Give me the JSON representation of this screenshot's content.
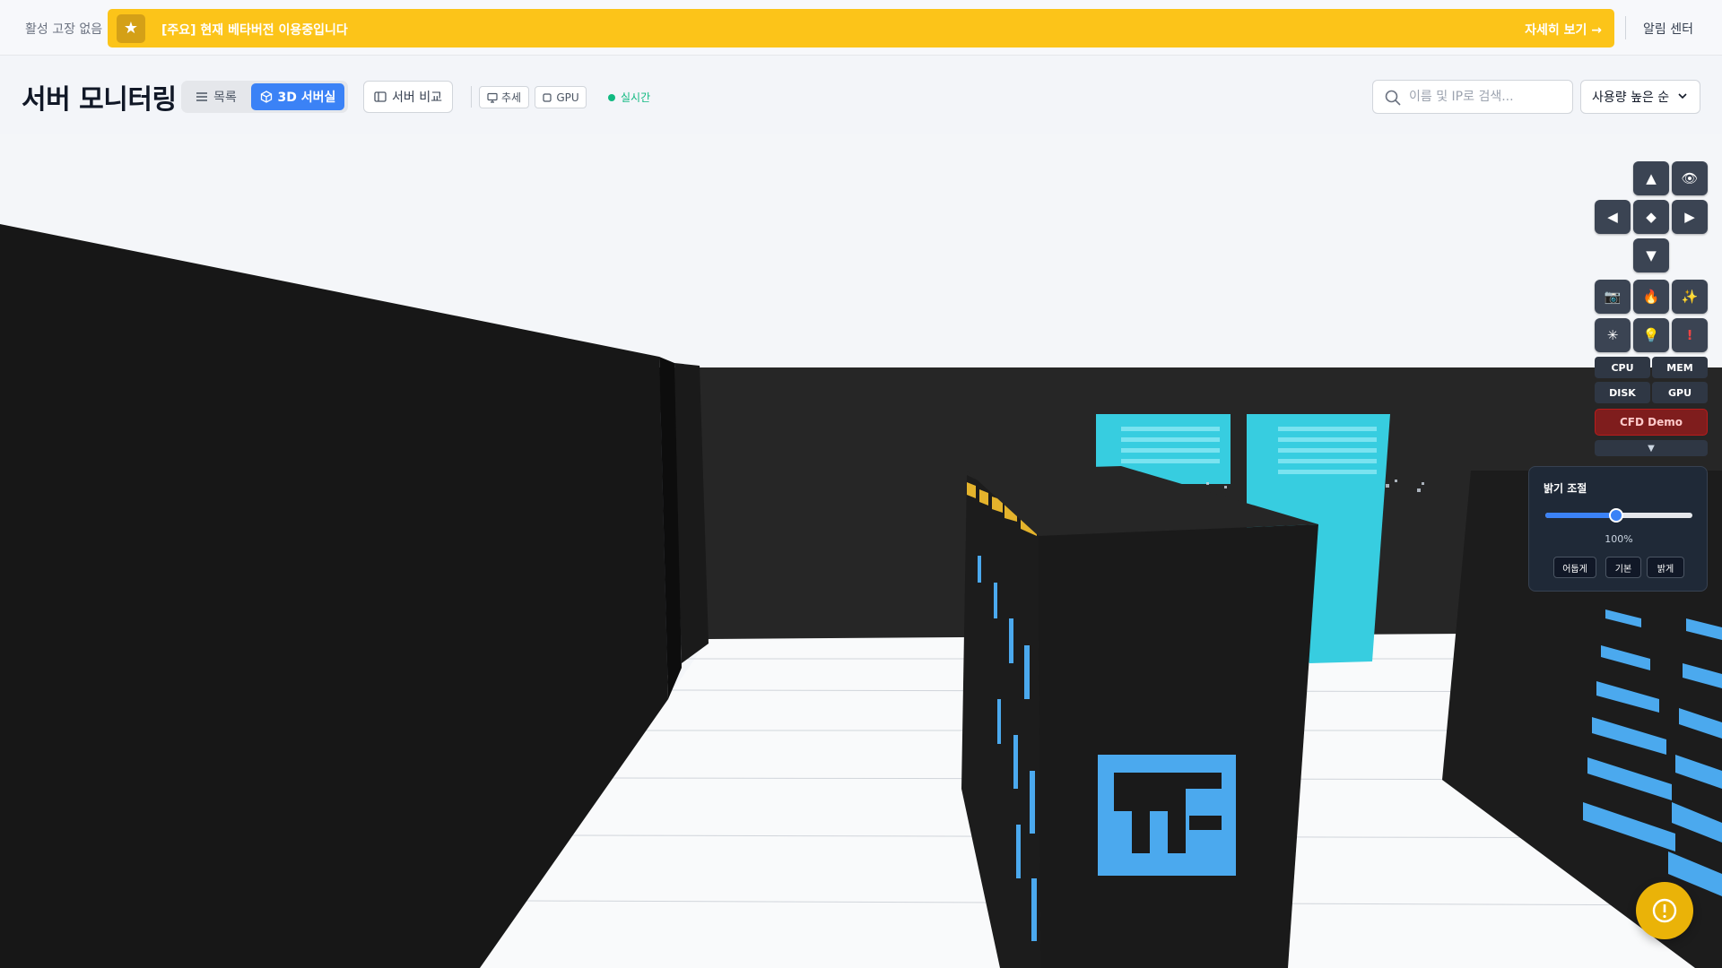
{
  "topbar": {
    "fault_status": "활성 고장 없음",
    "banner_text": "[주요] 현재 베타버전 이용중입니다",
    "banner_link": "자세히 보기 →",
    "alert_center": "알림 센터"
  },
  "header": {
    "title": "서버 모니터링",
    "view_list": "목록",
    "view_3d": "3D 서버실",
    "compare": "서버 비교",
    "chip_trend": "추세",
    "chip_gpu": "GPU",
    "live": "실시간",
    "search_placeholder": "이름 및 IP로 검색...",
    "sort_value": "사용량 높은 순"
  },
  "controls": {
    "metrics": [
      "CPU",
      "MEM",
      "DISK",
      "GPU"
    ],
    "cfd_demo": "CFD Demo"
  },
  "brightness": {
    "title": "밝기 조절",
    "value_label": "100%",
    "slider_fraction": 0.48,
    "buttons": [
      "어둡게",
      "기본",
      "밝게"
    ]
  },
  "colors": {
    "banner": "#fcc419",
    "accent": "#3b82f6",
    "live": "#10b981",
    "rack_dark": "#1a1a1a",
    "rack_panel": "#4ba9ee",
    "cyan_rack": "#37cde0"
  }
}
